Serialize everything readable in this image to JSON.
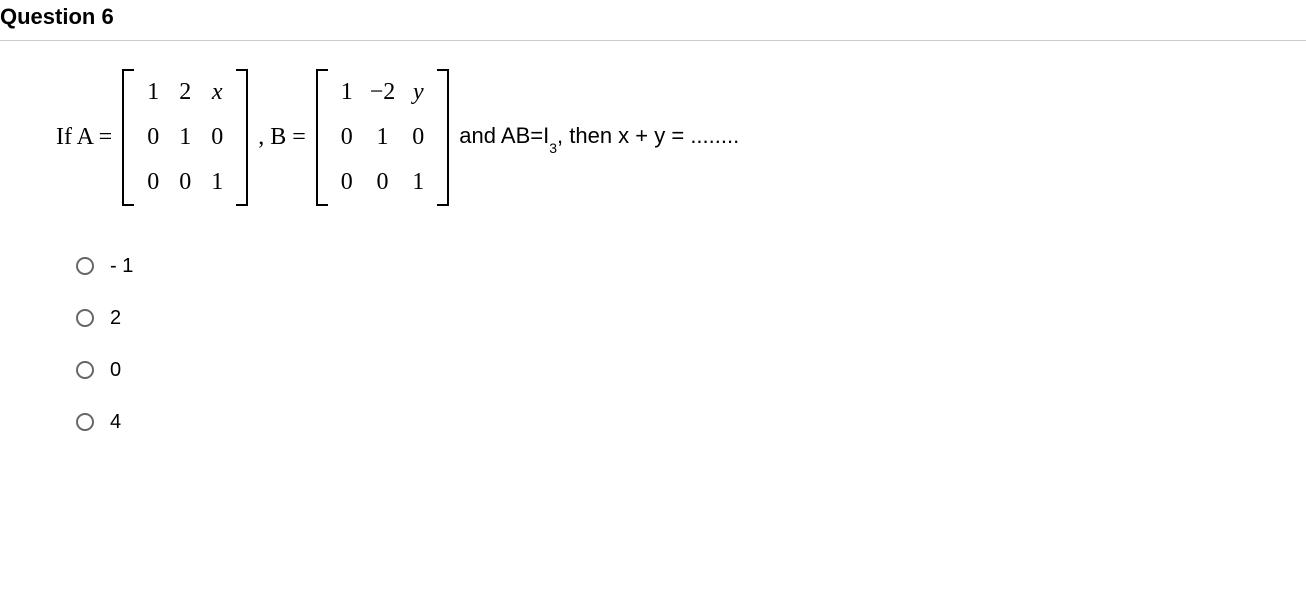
{
  "header": "Question 6",
  "problem": {
    "ifA": "If A =",
    "matrixA": [
      "1",
      "2",
      "x",
      "0",
      "1",
      "0",
      "0",
      "0",
      "1"
    ],
    "commaB": ", B =",
    "matrixB": [
      "1",
      "−2",
      "y",
      "0",
      "1",
      "0",
      "0",
      "0",
      "1"
    ],
    "and": "and AB=I",
    "sub3": "3",
    "then": ", then x + y = ........"
  },
  "options": [
    {
      "label": "- 1"
    },
    {
      "label": "2"
    },
    {
      "label": "0"
    },
    {
      "label": "4"
    }
  ]
}
